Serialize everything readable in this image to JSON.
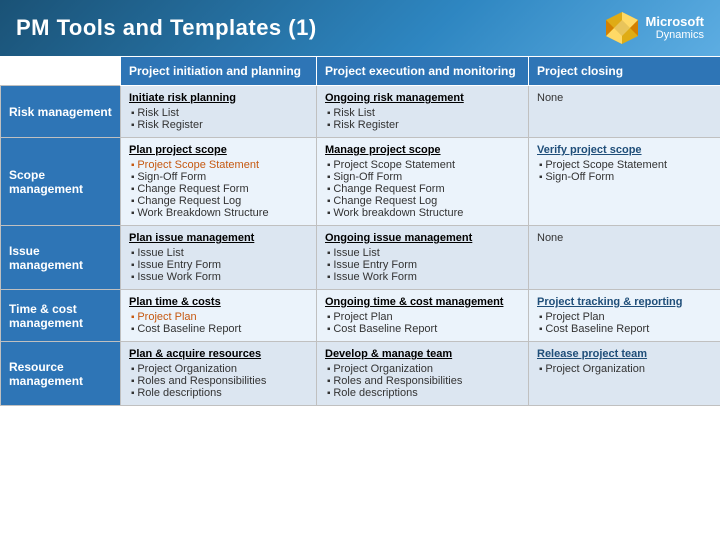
{
  "header": {
    "title": "PM Tools and Templates (1)",
    "logo_line1": "Microsoft",
    "logo_line2": "Dynamics"
  },
  "columns": {
    "col0": "",
    "col1": "Project initiation and planning",
    "col2": "Project execution and monitoring",
    "col3": "Project closing"
  },
  "rows": [
    {
      "category": "Risk management",
      "col1": {
        "title": "Initiate risk planning",
        "items": [
          "Risk List",
          "Risk Register"
        ],
        "highlight": []
      },
      "col2": {
        "title": "Ongoing risk management",
        "items": [
          "Risk List",
          "Risk Register"
        ],
        "highlight": []
      },
      "col3": {
        "title": "None",
        "items": [],
        "highlight": []
      }
    },
    {
      "category": "Scope management",
      "col1": {
        "title": "Plan project scope",
        "items": [
          "Project Scope Statement",
          "Sign-Off Form",
          "Change Request Form",
          "Change Request Log",
          "Work Breakdown Structure"
        ],
        "highlight": [
          0
        ]
      },
      "col2": {
        "title": "Manage project scope",
        "items": [
          "Project Scope Statement",
          "Sign-Off Form",
          "Change Request Form",
          "Change Request Log",
          "Work breakdown Structure"
        ],
        "highlight": []
      },
      "col3": {
        "title": "Verify project scope",
        "items": [
          "Project Scope Statement",
          "Sign-Off Form"
        ],
        "highlight": []
      }
    },
    {
      "category": "Issue management",
      "col1": {
        "title": "Plan issue management",
        "items": [
          "Issue List",
          "Issue Entry Form",
          "Issue Work Form"
        ],
        "highlight": []
      },
      "col2": {
        "title": "Ongoing issue management",
        "items": [
          "Issue List",
          "Issue Entry Form",
          "Issue Work Form"
        ],
        "highlight": []
      },
      "col3": {
        "title": "None",
        "items": [],
        "highlight": []
      }
    },
    {
      "category": "Time & cost management",
      "col1": {
        "title": "Plan time & costs",
        "items": [
          "Project Plan",
          "Cost Baseline Report"
        ],
        "highlight": [
          0
        ]
      },
      "col2": {
        "title": "Ongoing time & cost management",
        "items": [
          "Project Plan",
          "Cost Baseline Report"
        ],
        "highlight": []
      },
      "col3": {
        "title": "Project tracking & reporting",
        "items": [
          "Project Plan",
          "Cost Baseline Report"
        ],
        "highlight": []
      }
    },
    {
      "category": "Resource management",
      "col1": {
        "title": "Plan & acquire resources",
        "items": [
          "Project Organization",
          "Roles and Responsibilities",
          "Role descriptions"
        ],
        "highlight": []
      },
      "col2": {
        "title": "Develop & manage team",
        "items": [
          "Project Organization",
          "Roles and Responsibilities",
          "Role descriptions"
        ],
        "highlight": []
      },
      "col3": {
        "title": "Release project team",
        "items": [
          "Project Organization"
        ],
        "highlight": []
      }
    }
  ]
}
